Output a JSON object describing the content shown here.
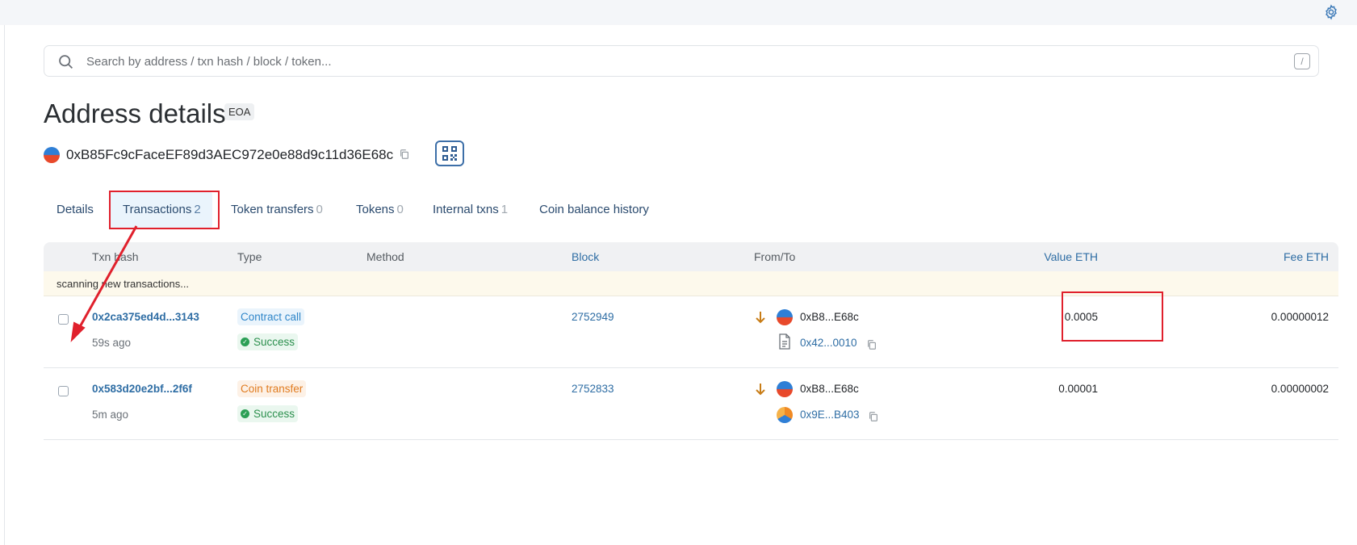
{
  "search": {
    "placeholder": "Search by address / txn hash / block / token...",
    "shortcut_key": "/"
  },
  "page": {
    "title": "Address details",
    "badge": "EOA"
  },
  "address": {
    "full": "0xB85Fc9cFaceEF89d3AEC972e0e88d9c11d36E68c"
  },
  "tabs": [
    {
      "label": "Details",
      "count": ""
    },
    {
      "label": "Transactions",
      "count": "2"
    },
    {
      "label": "Token transfers",
      "count": "0"
    },
    {
      "label": "Tokens",
      "count": "0"
    },
    {
      "label": "Internal txns",
      "count": "1"
    },
    {
      "label": "Coin balance history",
      "count": ""
    }
  ],
  "active_tab": "Transactions",
  "table": {
    "headers": {
      "txn_hash": "Txn hash",
      "type": "Type",
      "method": "Method",
      "block": "Block",
      "from_to": "From/To",
      "value": "Value ETH",
      "fee": "Fee ETH"
    },
    "scanning_text": "scanning new transactions...",
    "rows": [
      {
        "hash": "0x2ca375ed4d...3143",
        "age": "59s ago",
        "type": "Contract call",
        "status": "Success",
        "method": "",
        "block": "2752949",
        "from": "0xB8...E68c",
        "to": "0x42...0010",
        "value": "0.0005",
        "fee": "0.00000012"
      },
      {
        "hash": "0x583d20e2bf...2f6f",
        "age": "5m ago",
        "type": "Coin transfer",
        "status": "Success",
        "method": "",
        "block": "2752833",
        "from": "0xB8...E68c",
        "to": "0x9E...B403",
        "value": "0.00001",
        "fee": "0.00000002"
      }
    ]
  },
  "colors": {
    "link": "#2e6da4",
    "annotation": "#e0202c",
    "success": "#2b8f4d",
    "contract_call": "#2f86c9",
    "coin_transfer": "#e07b1f"
  }
}
